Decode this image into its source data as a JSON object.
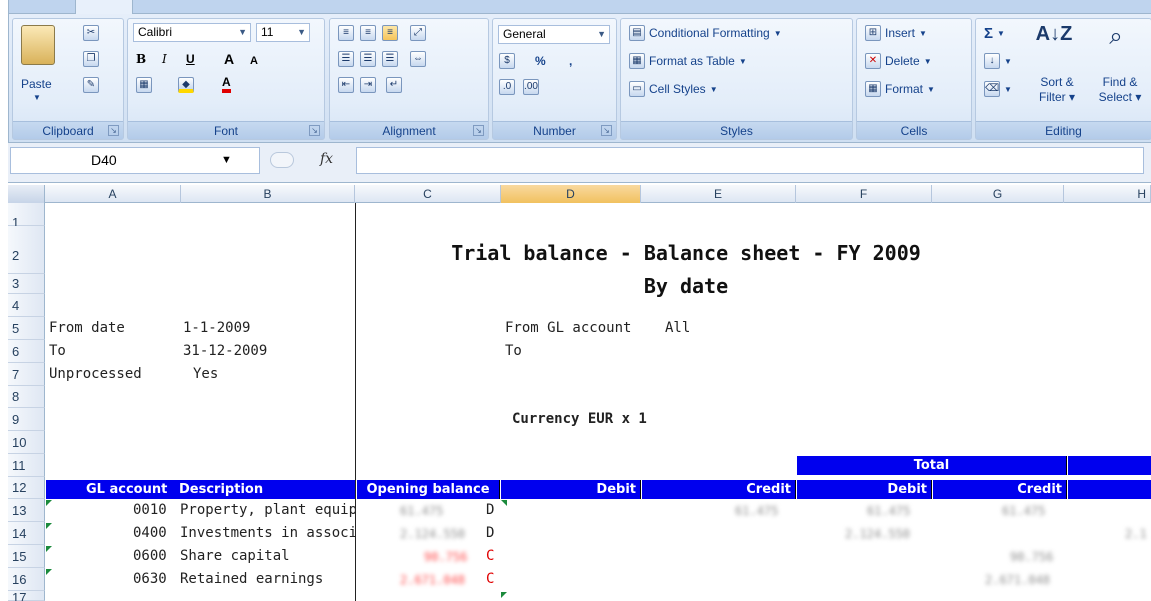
{
  "ribbon": {
    "clipboard": {
      "paste": "Paste",
      "label": "Clipboard"
    },
    "font": {
      "name": "Calibri",
      "size": "11",
      "label": "Font"
    },
    "alignment": {
      "label": "Alignment"
    },
    "number": {
      "format": "General",
      "percent": "%",
      "comma": ",",
      "label": "Number"
    },
    "styles": {
      "conditional": "Conditional Formatting",
      "format_table": "Format as Table",
      "cell_styles": "Cell Styles",
      "label": "Styles"
    },
    "cells": {
      "insert": "Insert",
      "delete": "Delete",
      "format": "Format",
      "label": "Cells"
    },
    "editing": {
      "sigma": "Σ",
      "sort": "Sort &",
      "filter": "Filter",
      "find": "Find &",
      "select": "Select",
      "label": "Editing"
    }
  },
  "formula_bar": {
    "name_box": "D40",
    "fx": "fx",
    "content": ""
  },
  "columns": [
    "A",
    "B",
    "C",
    "D",
    "E",
    "F",
    "G",
    "H"
  ],
  "rows": [
    "1",
    "2",
    "3",
    "4",
    "5",
    "6",
    "7",
    "8",
    "9",
    "10",
    "11",
    "12",
    "13",
    "14",
    "15",
    "16",
    "17"
  ],
  "sheet": {
    "title": "Trial balance - Balance sheet - FY 2009",
    "subtitle": "By date",
    "from_date_label": "From date",
    "from_date": "1-1-2009",
    "to_label": "To",
    "to_date": "31-12-2009",
    "unprocessed_label": "Unprocessed",
    "unprocessed": "Yes",
    "from_gl_label": "From GL account",
    "from_gl_value": "All",
    "to_gl_label": "To",
    "currency": "Currency EUR x  1",
    "total": "Total",
    "headers": {
      "gl_account": "GL account",
      "description": "Description",
      "opening_balance": "Opening balance",
      "debit": "Debit",
      "credit": "Credit",
      "total_debit": "Debit",
      "total_credit": "Credit"
    },
    "data_rows": [
      {
        "code": "0010",
        "description": "Property, plant equipm",
        "opening": "61.475",
        "dc": "D",
        "red": false,
        "credit": "61.475",
        "tdebit": "61.475",
        "tcredit": "61.475",
        "h": ""
      },
      {
        "code": "0400",
        "description": "Investments in associ",
        "opening": "2.124.550",
        "dc": "D",
        "red": false,
        "credit": "",
        "tdebit": "2.124.550",
        "tcredit": "",
        "h": "2.1"
      },
      {
        "code": "0600",
        "description": "Share capital",
        "opening": "90.756",
        "dc": "C",
        "red": true,
        "credit": "",
        "tdebit": "",
        "tcredit": "90.756",
        "h": ""
      },
      {
        "code": "0630",
        "description": "Retained earnings",
        "opening": "2.671.048",
        "dc": "C",
        "red": true,
        "credit": "",
        "tdebit": "",
        "tcredit": "2.671.048",
        "h": ""
      }
    ]
  },
  "colors": {
    "header_band": "#0000ee",
    "selected_col": "#f1c15f",
    "negative": "#ff0000",
    "ribbon_text": "#15428b"
  }
}
